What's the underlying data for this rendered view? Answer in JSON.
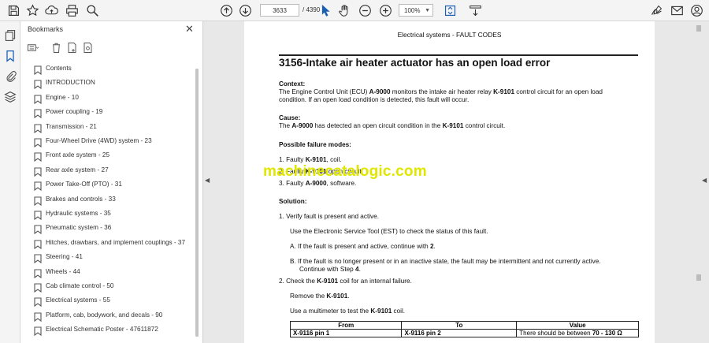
{
  "toolbar": {
    "page_current": "3633",
    "page_total": "/ 4390",
    "zoom": "100%",
    "icons": [
      "save-icon",
      "bookmark-star-icon",
      "cloud-upload-icon",
      "print-icon",
      "zoom-search-icon",
      "page-up-icon",
      "page-down-icon",
      "select-cursor-icon",
      "hand-icon",
      "zoom-out-icon",
      "zoom-in-icon",
      "page-fit-icon",
      "read-mode-icon",
      "sign-icon",
      "email-icon",
      "account-icon"
    ]
  },
  "panel": {
    "title": "Bookmarks",
    "items": [
      {
        "label": "Contents"
      },
      {
        "label": "INTRODUCTION"
      },
      {
        "label": "Engine - 10"
      },
      {
        "label": "Power coupling - 19"
      },
      {
        "label": "Transmission - 21"
      },
      {
        "label": "Four-Wheel Drive (4WD) system - 23"
      },
      {
        "label": "Front axle system - 25"
      },
      {
        "label": "Rear axle system - 27"
      },
      {
        "label": "Power Take-Off (PTO) - 31"
      },
      {
        "label": "Brakes and controls - 33"
      },
      {
        "label": "Hydraulic systems - 35"
      },
      {
        "label": "Pneumatic system - 36"
      },
      {
        "label": "Hitches, drawbars, and implement couplings - 37"
      },
      {
        "label": "Steering - 41"
      },
      {
        "label": "Wheels - 44"
      },
      {
        "label": "Cab climate control - 50"
      },
      {
        "label": "Electrical systems - 55"
      },
      {
        "label": "Platform, cab, bodywork, and decals - 90"
      },
      {
        "label": "Electrical Schematic Poster - 47611872"
      }
    ]
  },
  "doc": {
    "header": "Electrical systems - FAULT CODES",
    "title": "3156-Intake air heater actuator has an open load error",
    "context_heading": "Context:",
    "context_l1_a": "The Engine Control Unit (ECU) ",
    "context_l1_b": "A-9000",
    "context_l1_c": " monitors the intake air heater relay ",
    "context_l1_d": "K-9101",
    "context_l1_e": " control circuit for an open load",
    "context_l2": "condition.  If an open load condition is detected, this fault will occur.",
    "cause_heading": "Cause:",
    "cause_a": "The ",
    "cause_b": "A-9000",
    "cause_c": " has detected an open circuit condition in the ",
    "cause_d": "K-9101",
    "cause_e": " control circuit.",
    "modes_heading": "Possible failure modes:",
    "mode1_a": "1.  Faulty ",
    "mode1_b": "K-9101",
    "mode1_c": ", coil.",
    "mode2_a": "2.  Faulty ",
    "mode2_b": "K-9101",
    "mode2_c": " open circuit.",
    "mode3_a": "3.  Faulty ",
    "mode3_b": "A-9000",
    "mode3_c": ", software.",
    "watermark": "machinecatalogic.com",
    "solution_heading": "Solution:",
    "s1": "1.  Verify fault is present and active.",
    "s1_sub": "Use the Electronic Service Tool (EST) to check the status of this fault.",
    "s1a_a": "A.  If the fault is present and active, continue with ",
    "s1a_b": "2",
    "s1a_c": ".",
    "s1b_l1": "B.  If the fault is no longer present or in an inactive state, the fault may be intermittent and not currently active.",
    "s1b_l2_a": "Continue with Step ",
    "s1b_l2_b": "4",
    "s1b_l2_c": ".",
    "s2_a": "2.  Check the ",
    "s2_b": "K-9101",
    "s2_c": " coil for an internal failure.",
    "s2_remove_a": "Remove the ",
    "s2_remove_b": "K-9101",
    "s2_remove_c": ".",
    "s2_mm_a": "Use a multimeter to test the ",
    "s2_mm_b": "K-9101",
    "s2_mm_c": " coil.",
    "table": {
      "headers": [
        "From",
        "To",
        "Value"
      ],
      "row_from": "X-9116 pin 1",
      "row_to": "X-9116 pin 2",
      "row_value_a": "There should be between ",
      "row_value_b": "70 - 130 Ω"
    }
  }
}
